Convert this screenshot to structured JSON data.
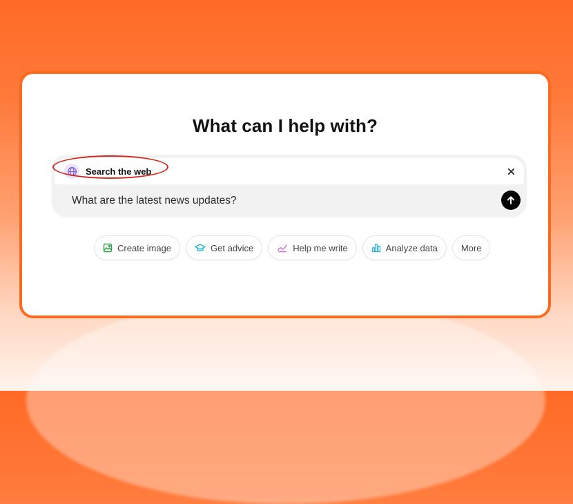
{
  "heading": "What can I help with?",
  "composer": {
    "tool_label": "Search the web",
    "tool_icon": "globe-icon",
    "prompt_text": "What are the latest news updates?",
    "close_icon": "close-icon",
    "send_icon": "arrow-up-icon"
  },
  "actions": [
    {
      "label": "Create image",
      "icon": "image-icon",
      "color": "#2f9e44"
    },
    {
      "label": "Get advice",
      "icon": "graduation-cap-icon",
      "color": "#22b8cf"
    },
    {
      "label": "Help me write",
      "icon": "pen-icon",
      "color": "#c56fd3"
    },
    {
      "label": "Analyze data",
      "icon": "bar-chart-icon",
      "color": "#3bb3d6"
    },
    {
      "label": "More",
      "icon": "",
      "color": ""
    }
  ],
  "colors": {
    "accent_border": "#ff6a1f",
    "highlight_ring": "#d22a1e",
    "globe_tint": "#7b5bd6",
    "send_button": "#000000"
  }
}
